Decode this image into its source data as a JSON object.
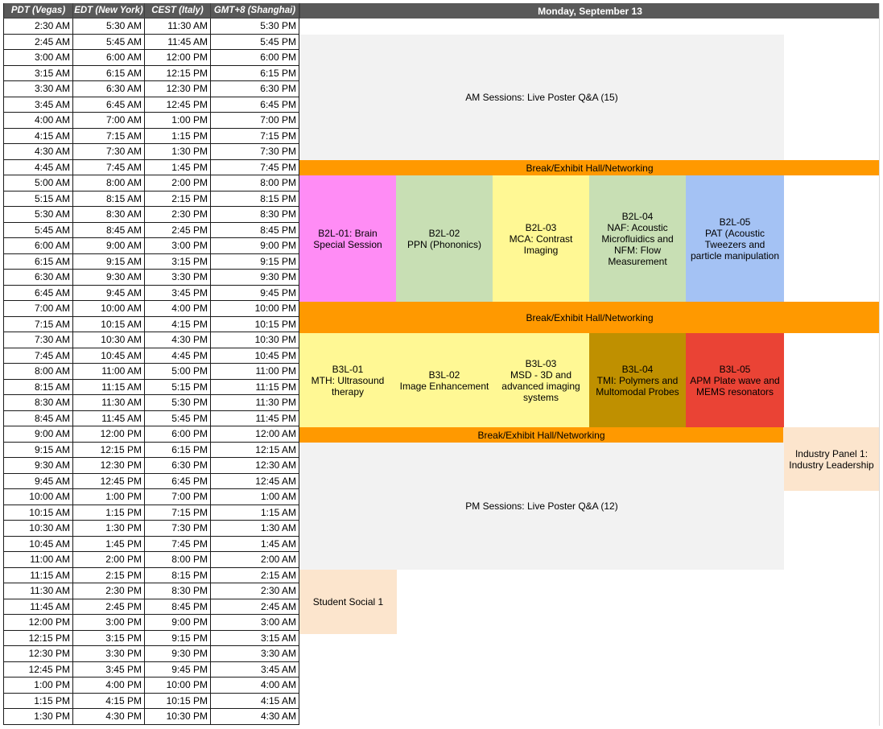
{
  "headers": {
    "pdt": "PDT (Vegas)",
    "edt": "EDT (New York)",
    "cest": "CEST (Italy)",
    "gmt": "GMT+8 (Shanghai)",
    "day": "Monday, September 13"
  },
  "rows": [
    [
      "2:30 AM",
      "5:30 AM",
      "11:30 AM",
      "5:30 PM"
    ],
    [
      "2:45 AM",
      "5:45 AM",
      "11:45 AM",
      "5:45 PM"
    ],
    [
      "3:00 AM",
      "6:00 AM",
      "12:00 PM",
      "6:00 PM"
    ],
    [
      "3:15 AM",
      "6:15 AM",
      "12:15 PM",
      "6:15 PM"
    ],
    [
      "3:30 AM",
      "6:30 AM",
      "12:30 PM",
      "6:30 PM"
    ],
    [
      "3:45 AM",
      "6:45 AM",
      "12:45 PM",
      "6:45 PM"
    ],
    [
      "4:00 AM",
      "7:00 AM",
      "1:00 PM",
      "7:00 PM"
    ],
    [
      "4:15 AM",
      "7:15 AM",
      "1:15 PM",
      "7:15 PM"
    ],
    [
      "4:30 AM",
      "7:30 AM",
      "1:30 PM",
      "7:30 PM"
    ],
    [
      "4:45 AM",
      "7:45 AM",
      "1:45 PM",
      "7:45 PM"
    ],
    [
      "5:00 AM",
      "8:00 AM",
      "2:00 PM",
      "8:00 PM"
    ],
    [
      "5:15 AM",
      "8:15 AM",
      "2:15 PM",
      "8:15 PM"
    ],
    [
      "5:30 AM",
      "8:30 AM",
      "2:30 PM",
      "8:30 PM"
    ],
    [
      "5:45 AM",
      "8:45 AM",
      "2:45 PM",
      "8:45 PM"
    ],
    [
      "6:00 AM",
      "9:00 AM",
      "3:00 PM",
      "9:00 PM"
    ],
    [
      "6:15 AM",
      "9:15 AM",
      "3:15 PM",
      "9:15 PM"
    ],
    [
      "6:30 AM",
      "9:30 AM",
      "3:30 PM",
      "9:30 PM"
    ],
    [
      "6:45 AM",
      "9:45 AM",
      "3:45 PM",
      "9:45 PM"
    ],
    [
      "7:00 AM",
      "10:00 AM",
      "4:00 PM",
      "10:00 PM"
    ],
    [
      "7:15 AM",
      "10:15 AM",
      "4:15 PM",
      "10:15 PM"
    ],
    [
      "7:30 AM",
      "10:30 AM",
      "4:30 PM",
      "10:30 PM"
    ],
    [
      "7:45 AM",
      "10:45 AM",
      "4:45 PM",
      "10:45 PM"
    ],
    [
      "8:00 AM",
      "11:00 AM",
      "5:00 PM",
      "11:00 PM"
    ],
    [
      "8:15 AM",
      "11:15 AM",
      "5:15 PM",
      "11:15 PM"
    ],
    [
      "8:30 AM",
      "11:30 AM",
      "5:30 PM",
      "11:30 PM"
    ],
    [
      "8:45 AM",
      "11:45 AM",
      "5:45 PM",
      "11:45 PM"
    ],
    [
      "9:00 AM",
      "12:00 PM",
      "6:00 PM",
      "12:00 AM"
    ],
    [
      "9:15 AM",
      "12:15 PM",
      "6:15 PM",
      "12:15 AM"
    ],
    [
      "9:30 AM",
      "12:30 PM",
      "6:30 PM",
      "12:30 AM"
    ],
    [
      "9:45 AM",
      "12:45 PM",
      "6:45 PM",
      "12:45 AM"
    ],
    [
      "10:00 AM",
      "1:00 PM",
      "7:00 PM",
      "1:00 AM"
    ],
    [
      "10:15 AM",
      "1:15 PM",
      "7:15 PM",
      "1:15 AM"
    ],
    [
      "10:30 AM",
      "1:30 PM",
      "7:30 PM",
      "1:30 AM"
    ],
    [
      "10:45 AM",
      "1:45 PM",
      "7:45 PM",
      "1:45 AM"
    ],
    [
      "11:00 AM",
      "2:00 PM",
      "8:00 PM",
      "2:00 AM"
    ],
    [
      "11:15 AM",
      "2:15 PM",
      "8:15 PM",
      "2:15 AM"
    ],
    [
      "11:30 AM",
      "2:30 PM",
      "8:30 PM",
      "2:30 AM"
    ],
    [
      "11:45 AM",
      "2:45 PM",
      "8:45 PM",
      "2:45 AM"
    ],
    [
      "12:00 PM",
      "3:00 PM",
      "9:00 PM",
      "3:00 AM"
    ],
    [
      "12:15 PM",
      "3:15 PM",
      "9:15 PM",
      "3:15 AM"
    ],
    [
      "12:30 PM",
      "3:30 PM",
      "9:30 PM",
      "3:30 AM"
    ],
    [
      "12:45 PM",
      "3:45 PM",
      "9:45 PM",
      "3:45 AM"
    ],
    [
      "1:00 PM",
      "4:00 PM",
      "10:00 PM",
      "4:00 AM"
    ],
    [
      "1:15 PM",
      "4:15 PM",
      "10:15 PM",
      "4:15 AM"
    ],
    [
      "1:30 PM",
      "4:30 PM",
      "10:30 PM",
      "4:30 AM"
    ]
  ],
  "events": {
    "am_poster": "AM Sessions: Live Poster Q&A (15)",
    "break1": "Break/Exhibit Hall/Networking",
    "b2l01": "B2L-01: Brain\nSpecial Session",
    "b2l02": "B2L-02\nPPN (Phononics)",
    "b2l03": "B2L-03\nMCA: Contrast\nImaging",
    "b2l04": "B2L-04\nNAF: Acoustic\nMicrofluidics and\nNFM: Flow\nMeasurement",
    "b2l05": "B2L-05\nPAT (Acoustic\nTweezers and\nparticle manipulation",
    "break2": "Break/Exhibit Hall/Networking",
    "b3l01": "B3L-01\nMTH: Ultrasound\ntherapy",
    "b3l02": "B3L-02\nImage Enhancement",
    "b3l03": "B3L-03\nMSD - 3D and\nadvanced imaging\nsystems",
    "b3l04": "B3L-04\nTMI: Polymers and\nMultomodal Probes",
    "b3l05": "B3L-05\nAPM Plate wave and\nMEMS resonators",
    "break3": "Break/Exhibit Hall/Networking",
    "industry_panel": "Industry Panel 1:\nIndustry Leadership",
    "pm_poster": "PM Sessions: Live Poster Q&A (12)",
    "student_social": "Student Social 1"
  },
  "colors": {
    "header_bg": "#595959",
    "poster_gray": "#f2f2f2",
    "break_orange": "#ff9900",
    "peach": "#fce5cd",
    "pink": "#ff8cf5",
    "green": "#c8dfb4",
    "yellow": "#fff894",
    "blue": "#a4c2f4",
    "gold": "#bf9000",
    "red": "#ea4335"
  }
}
